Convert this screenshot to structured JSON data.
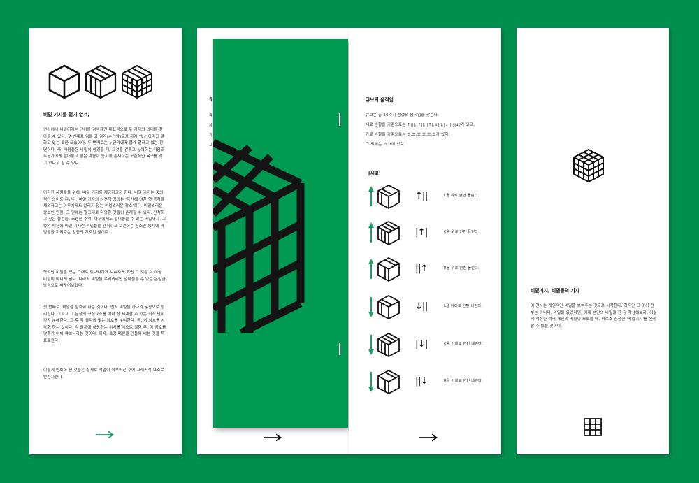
{
  "colors": {
    "background": "#008f4f",
    "panel": "#ffffff",
    "cover": "#009a52",
    "accent": "#19a062",
    "ink": "#222222"
  },
  "panel1": {
    "icons": [
      "cube-plain-icon",
      "cube-vertical-slices-icon",
      "cube-grid-icon"
    ],
    "heading": "비밀 기지를 열기 앞서,",
    "paragraphs": [
      "언어에서 비밀이라는 단어를 검색하면 대표적으로 두 가지의 의미를 찾아볼 수 있다. 첫 번째로 임을 과 검지(손가락)으로 하지 '쉿.' 이라고 말하고 있는 듯한 모습이다. 두 번째로는 누군가에게 몰래 말하고 있는 장면이다. 즉, 사람들은 비밀이 생겼을 때, 그것을 감추고 싶어하는 마음과 누군가에게 털어놓고 싶은 마음이 동시에 존재하는 모순적인 욕구를 갖고 있다고 할 수 있다.",
      "이러한 사람들을 위해, 비밀 기지를 제공하고자 한다. 비밀 기지는 중의적인 의미를 지닌다. 비밀 기지의 사전적 정의는 '자신에 의한 옛 목적을 제외하고는 아무에게도 알리지 않는 비밀스러운 장소'이다. 비밀스러운 장소인 만큼, 그 안에는 말그대로 다양한 것들이 존재할 수 있다. 간직하고 싶은 물건들, 소중한 추억, 아무에게도 털어놓을 수 있는 비밀까지. 그렇기 때문에 비밀 기지란 비밀들을 간직하고 보관하는 장소인 동시에 비밀들을 지켜주는 일종의 기지인 셈이다.",
      "하지만 비밀을 있는 그대로 적나라하게 보여주게 되면 그 것은 더 이상 비밀이 아니게 된다. 따라서 비밀을 우리끼리만 알아들을 수 있는 은밀한 방식으로 바꾸어보았다.",
      "첫 번째로, 비밀을 암호화 하는 것이다. 먼저 비밀을 하나의 문장으로 정리한다. 그리고 그 문장의 구성요소를 이미 상 세계할 수 있는 최소 단위까지 분해한다. 그 후 각 글자에 맞는 암호를 부여한다. 즉, 이 암호를 시각화 하는 것이다. 각 글자에 해당하는 위치를 색으로 칠한 후, 이 암호를 맞추기 위해 큐브나가는 것이다. 이때, 특정 패턴을 만들어 내는 것을 목표로한다.",
      "이렇게 암호화 된 것들은 실제로 작업이 이루어진 후에 그래픽적 요소로 변환시킨다."
    ]
  },
  "panel2": {
    "visible_title_initial": "큐",
    "visible_text_initials": [
      "큐",
      "세",
      "가",
      "그"
    ]
  },
  "panel3": {
    "heading": "큐브의 움직임",
    "intro": [
      "큐브는 총 16가지 방향의 움직임을 갖는다.",
      "세로 방향을 기준으로는 ↑|||,|↑||,||↑|,↓|||,|↓||,||↓|가 있고,",
      "가로 방향을 기준으로는 ☰,☰,☰,☰,☰,☰가 있다.",
      "그 외에는 ↻,↺이 있다."
    ],
    "section_label": "[세로]",
    "moves": [
      {
        "symbol": "↑||",
        "text": "L을 위로 한번 돌린다."
      },
      {
        "symbol": "|↑|",
        "text": "C를 위로 한번 돌린다."
      },
      {
        "symbol": "||↑",
        "text": "R을 위로 한번 돌린다."
      },
      {
        "symbol": "↓||",
        "text": "L을 아래로 한번 내린다."
      },
      {
        "symbol": "|↓|",
        "text": "C를 아래로 한번 내린다."
      },
      {
        "symbol": "||↓",
        "text": "R을 아래로 한번 내린다."
      }
    ]
  },
  "panel4": {
    "heading": "비밀기지, 비밀들의 기지",
    "paragraph": "이 전시는 개인적인 비밀을 보여주는 것으로 시작한다. 하지만 그 것이 전부는 아니다. 비밀을 읽었다면, 이제 본인의 비밀을 한 장 작성해보자. 이렇게 작성한 여러 개인의 비밀이 모였을 때, 비로소 진정한 '비밀기지'를 완성할 수 있을 것이다."
  },
  "arrows": [
    "next-arrow-green",
    "next-arrow-dark",
    "next-arrow-dark"
  ]
}
